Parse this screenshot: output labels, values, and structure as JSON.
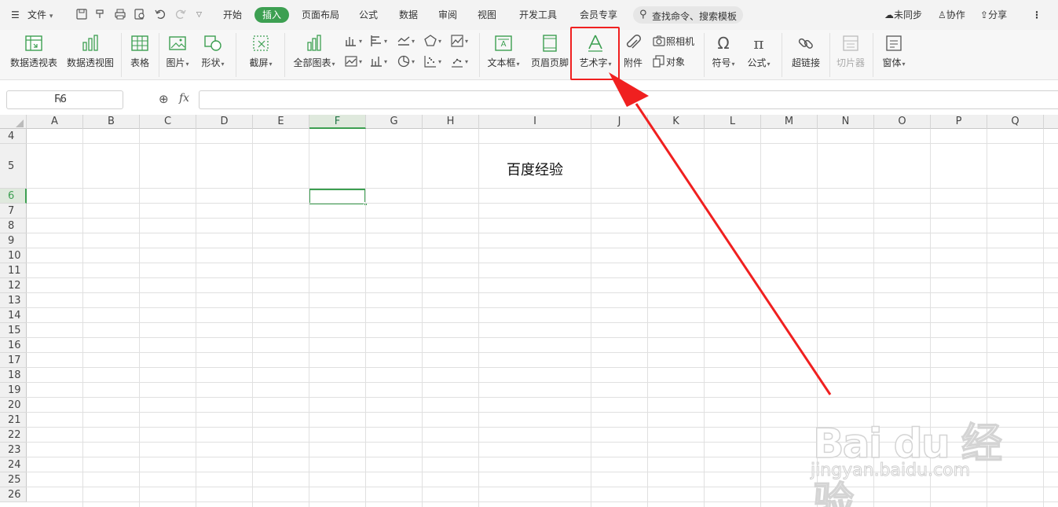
{
  "menubar": {
    "file_label": "文件",
    "tabs": [
      "开始",
      "插入",
      "页面布局",
      "公式",
      "数据",
      "审阅",
      "视图",
      "开发工具",
      "会员专享"
    ],
    "active_tab": "插入",
    "search_text": "查找命令、搜索模板",
    "sync_label": "未同步",
    "collab_label": "协作",
    "share_label": "分享"
  },
  "ribbon": {
    "pivot_table": "数据透视表",
    "pivot_chart": "数据透视图",
    "table": "表格",
    "picture": "图片",
    "shape": "形状",
    "screenshot": "截屏",
    "all_charts": "全部图表",
    "textbox": "文本框",
    "header_footer": "页眉页脚",
    "wordart": "艺术字",
    "attachment": "附件",
    "camera": "照相机",
    "object": "对象",
    "symbol": "符号",
    "formula": "公式",
    "hyperlink": "超链接",
    "slicer": "切片器",
    "window": "窗体"
  },
  "formula_bar": {
    "cell_reference": "F6",
    "fx_label": "fx",
    "formula_value": ""
  },
  "grid": {
    "columns": [
      "A",
      "B",
      "C",
      "D",
      "E",
      "F",
      "G",
      "H",
      "I",
      "J",
      "K",
      "L",
      "M",
      "N",
      "O",
      "P",
      "Q"
    ],
    "rows": [
      "4",
      "5",
      "6",
      "7",
      "8",
      "9",
      "10",
      "11",
      "12",
      "13",
      "14",
      "15",
      "16",
      "17",
      "18",
      "19",
      "20",
      "21",
      "22",
      "23",
      "24",
      "25",
      "26"
    ],
    "selected_column": "F",
    "selected_row": "6",
    "cell_I5": "百度经验"
  },
  "watermark": {
    "brand": "Bai du 经验",
    "url": "jingyan.baidu.com"
  },
  "annotation": {
    "highlight_color": "#f02020"
  },
  "colors": {
    "accent_green": "#3c9f51",
    "menubar_bg": "#f3f3f3",
    "ribbon_bg": "#f7f7f7"
  }
}
